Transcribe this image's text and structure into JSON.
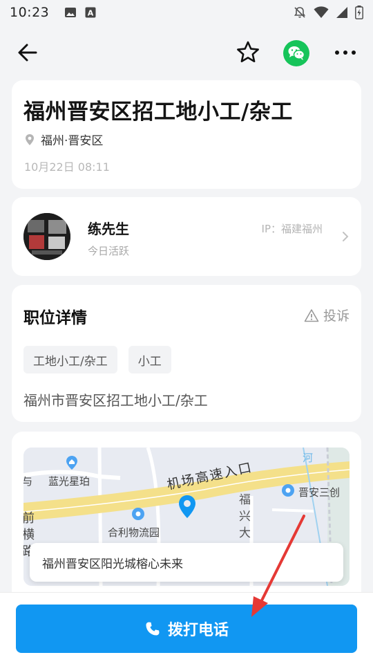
{
  "status_bar": {
    "time": "10:23",
    "left_icons": [
      "image-icon",
      "font-a-icon"
    ],
    "right_icons": [
      "mute-icon",
      "wifi-icon",
      "signal-icon",
      "battery-icon"
    ]
  },
  "nav": {
    "back_icon": "arrow-left-icon",
    "favorite_icon": "star-outline-icon",
    "share_icon": "wechat-icon",
    "more_icon": "more-dots-icon"
  },
  "job": {
    "title": "福州晋安区招工地小工/杂工",
    "location": "福州·晋安区",
    "posted_time": "10月22日 08:11"
  },
  "poster": {
    "name": "练先生",
    "status": "今日活跃",
    "ip": "IP：福建福州"
  },
  "detail": {
    "heading": "职位详情",
    "report_label": "投诉",
    "tags": [
      "工地小工/杂工",
      "小工"
    ],
    "description": "福州市晋安区招工地小工/杂工"
  },
  "map": {
    "labels": {
      "blue_star": "蓝光星珀",
      "airport_road": "机场高速入口",
      "jinan": "晋安三创",
      "heli": "合利物流园",
      "fuxing": "福兴大",
      "river": "河",
      "left_edge_1": "前",
      "left_edge_2": "横",
      "left_edge_3": "路",
      "left_edge_top": "与"
    },
    "address": "福州晋安区阳光城榕心未来"
  },
  "call_button": {
    "label": "拨打电话"
  },
  "colors": {
    "primary": "#1197f2",
    "wechat": "#16c45a",
    "road_yellow": "#f4e08a",
    "annotation_red": "#e53935"
  }
}
